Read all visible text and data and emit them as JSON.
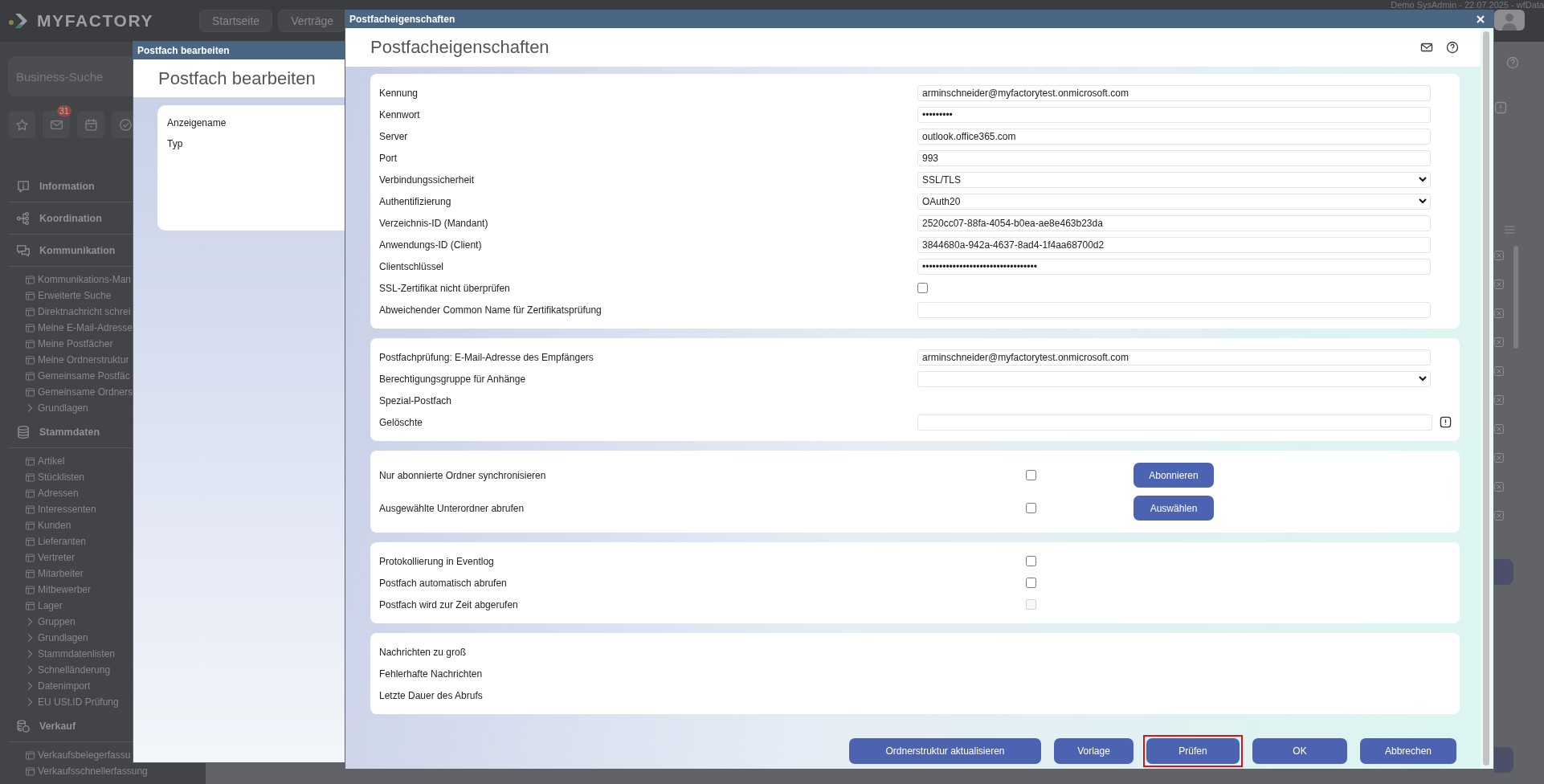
{
  "app": {
    "logo": "MYFACTORY",
    "nav": [
      {
        "label": "Startseite"
      },
      {
        "label": "Verträge"
      }
    ],
    "session": "Demo SysAdmin - 22.07.2025 - wfData"
  },
  "sidebar": {
    "search": {
      "placeholder": "Business-Suche"
    },
    "quick_actions": [
      {
        "kind": "star"
      },
      {
        "kind": "mail",
        "badge": "31"
      },
      {
        "kind": "calendar"
      },
      {
        "kind": "check"
      }
    ],
    "sections": [
      {
        "title": "Information",
        "kind": "info"
      },
      {
        "title": "Koordination",
        "kind": "hierarchy"
      },
      {
        "title": "Kommunikation",
        "kind": "chat",
        "items": [
          {
            "label": "Kommunikations-Man",
            "kind": "page"
          },
          {
            "label": "Erweiterte Suche",
            "kind": "page"
          },
          {
            "label": "Direktnachricht schrei",
            "kind": "page"
          },
          {
            "label": "Meine E-Mail-Adresse",
            "kind": "page"
          },
          {
            "label": "Meine Postfächer",
            "kind": "page"
          },
          {
            "label": "Meine Ordnerstruktur",
            "kind": "page"
          },
          {
            "label": "Gemeinsame Postfäc",
            "kind": "page"
          },
          {
            "label": "Gemeinsame Ordners",
            "kind": "page"
          },
          {
            "label": "Grundlagen",
            "kind": "group"
          }
        ]
      },
      {
        "title": "Stammdaten",
        "kind": "database",
        "items": [
          {
            "label": "Artikel",
            "kind": "page"
          },
          {
            "label": "Stücklisten",
            "kind": "page"
          },
          {
            "label": "Adressen",
            "kind": "page"
          },
          {
            "label": "Interessenten",
            "kind": "page"
          },
          {
            "label": "Kunden",
            "kind": "page"
          },
          {
            "label": "Lieferanten",
            "kind": "page"
          },
          {
            "label": "Vertreter",
            "kind": "page"
          },
          {
            "label": "Mitarbeiter",
            "kind": "page"
          },
          {
            "label": "Mitbewerber",
            "kind": "page"
          },
          {
            "label": "Lager",
            "kind": "page"
          },
          {
            "label": "Gruppen",
            "kind": "group"
          },
          {
            "label": "Grundlagen",
            "kind": "group"
          },
          {
            "label": "Stammdatenlisten",
            "kind": "group"
          },
          {
            "label": "Schnelländerung",
            "kind": "group"
          },
          {
            "label": "Datenimport",
            "kind": "group"
          },
          {
            "label": "EU USt.ID Prüfung",
            "kind": "group"
          }
        ]
      },
      {
        "title": "Verkauf",
        "kind": "coins",
        "items": [
          {
            "label": "Verkaufsbelegerfassu",
            "kind": "page"
          },
          {
            "label": "Verkaufsschnellerfassung",
            "kind": "page"
          }
        ]
      }
    ]
  },
  "back_dialog": {
    "title": "Postfach bearbeiten",
    "heading": "Postfach bearbeiten",
    "fields": [
      {
        "label": "Anzeigename"
      },
      {
        "label": "Typ"
      }
    ]
  },
  "dialog": {
    "title": "Postfacheigenschaften",
    "heading": "Postfacheigenschaften",
    "panels": [
      {
        "kind": "form",
        "rows": [
          {
            "label": "Kennung",
            "kind": "text",
            "value": "arminschneider@myfactorytest.onmicrosoft.com"
          },
          {
            "label": "Kennwort",
            "kind": "text",
            "value": "•••••••••"
          },
          {
            "label": "Server",
            "kind": "text",
            "value": "outlook.office365.com"
          },
          {
            "label": "Port",
            "kind": "text",
            "value": "993"
          },
          {
            "label": "Verbindungssicherheit",
            "kind": "select",
            "value": "SSL/TLS"
          },
          {
            "label": "Authentifizierung",
            "kind": "select",
            "value": "OAuth20"
          },
          {
            "label": "Verzeichnis-ID (Mandant)",
            "kind": "text",
            "value": "2520cc07-88fa-4054-b0ea-ae8e463b23da"
          },
          {
            "label": "Anwendungs-ID (Client)",
            "kind": "text",
            "value": "3844680a-942a-4637-8ad4-1f4aa68700d2"
          },
          {
            "label": "Clientschlüssel",
            "kind": "text",
            "value": "••••••••••••••••••••••••••••••••••"
          },
          {
            "label": "SSL-Zertifikat nicht überprüfen",
            "kind": "checkbox",
            "checked": false,
            "disabled": false
          },
          {
            "label": "Abweichender Common Name für Zertifikatsprüfung",
            "kind": "text"
          }
        ]
      },
      {
        "kind": "form",
        "rows": [
          {
            "label": "Postfachprüfung: E-Mail-Adresse des Empfängers",
            "kind": "text",
            "value": "arminschneider@myfactorytest.onmicrosoft.com"
          },
          {
            "label": "Berechtigungsgruppe für Anhänge",
            "kind": "select"
          },
          {
            "label": "Spezial-Postfach",
            "kind": "label"
          },
          {
            "label": "Gelöschte",
            "kind": "text_alert"
          }
        ]
      },
      {
        "kind": "options",
        "rows": [
          {
            "label": "Nur abonnierte Ordner synchronisieren",
            "kind": "checkbox",
            "checked": false,
            "disabled": false,
            "button": "Abonnieren"
          },
          {
            "label": "Ausgewählte Unterordner abrufen",
            "kind": "checkbox",
            "checked": false,
            "disabled": false,
            "button": "Auswählen"
          }
        ]
      },
      {
        "kind": "options",
        "rows": [
          {
            "label": "Protokollierung in Eventlog",
            "kind": "checkbox",
            "checked": false,
            "disabled": false
          },
          {
            "label": "Postfach automatisch abrufen",
            "kind": "checkbox",
            "checked": false,
            "disabled": false
          },
          {
            "label": "Postfach wird zur Zeit abgerufen",
            "kind": "checkbox",
            "checked": false,
            "disabled": true
          }
        ]
      },
      {
        "kind": "form",
        "rows": [
          {
            "label": "Nachrichten zu groß",
            "kind": "label"
          },
          {
            "label": "Fehlerhafte Nachrichten",
            "kind": "label"
          },
          {
            "label": "Letzte Dauer des Abrufs",
            "kind": "label"
          }
        ]
      }
    ],
    "buttons": [
      {
        "label": "Ordnerstruktur aktualisieren",
        "highlighted": false
      },
      {
        "label": "Vorlage",
        "highlighted": false
      },
      {
        "label": "Prüfen",
        "highlighted": true
      },
      {
        "label": "OK",
        "highlighted": false
      },
      {
        "label": "Abbrechen",
        "highlighted": false
      }
    ]
  }
}
